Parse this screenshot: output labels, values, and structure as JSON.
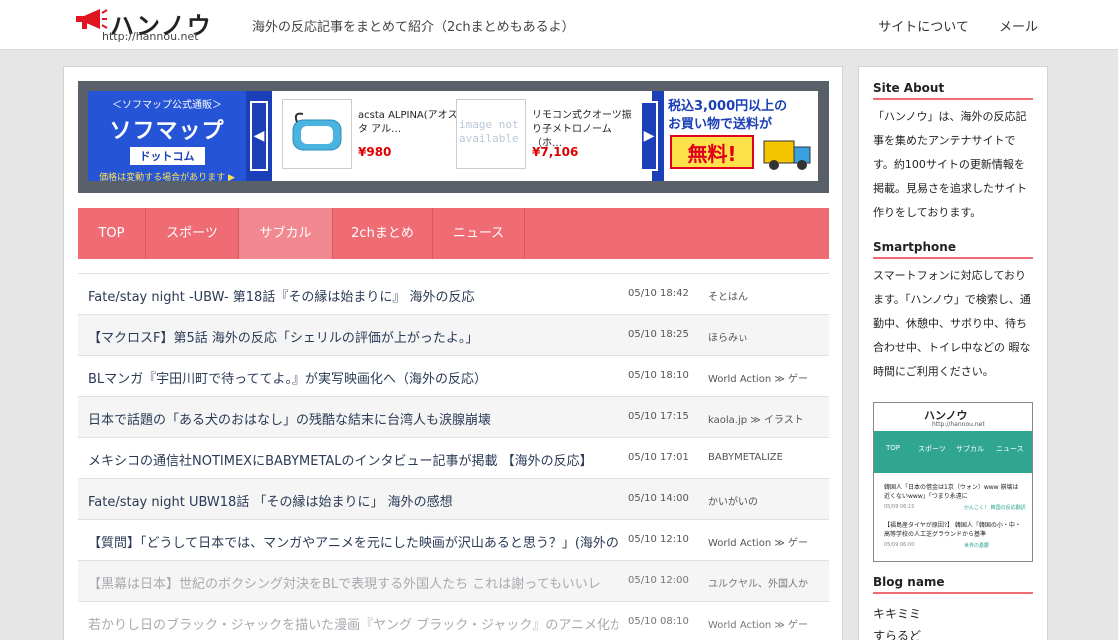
{
  "header": {
    "logo_text": "ハンノウ",
    "logo_url": "http://hannou.net",
    "tagline": "海外の反応記事をまとめて紹介（2chまとめもあるよ）",
    "nav": [
      "サイトについて",
      "メール"
    ]
  },
  "ad": {
    "brand_top": "＜ソフマップ公式通販＞",
    "brand_main": "ソフマップ",
    "brand_sub": "ドットコム",
    "brand_note": "価格は変動する場合があります ▶",
    "products": [
      {
        "name": "acsta ALPINA(アオスタ アル…",
        "price": "¥980"
      },
      {
        "name": "リモコン式クオーツ振り子メトロノーム（ホ…",
        "price": "¥7,106"
      }
    ],
    "no_image": "image not available",
    "promo_1": "税込3,000円以上の",
    "promo_2": "お買い物で送料が",
    "promo_3": "無料!"
  },
  "nav": {
    "items": [
      "TOP",
      "スポーツ",
      "サブカル",
      "2chまとめ",
      "ニュース"
    ],
    "active": "サブカル"
  },
  "articles": [
    {
      "title": "Fate/stay night -UBW- 第18話『その縁は始まりに』 海外の反応",
      "date": "05/10 18:42",
      "source": "そとはん"
    },
    {
      "title": "【マクロスF】第5話 海外の反応「シェリルの評価が上がったよ。」",
      "date": "05/10 18:25",
      "source": "ほらみぃ"
    },
    {
      "title": "BLマンガ『宇田川町で待っててよ。』が実写映画化へ（海外の反応）",
      "date": "05/10 18:10",
      "source": "World Action ≫ ゲー"
    },
    {
      "title": "日本で話題の「ある犬のおはなし」の残酷な結末に台湾人も涙腺崩壊",
      "date": "05/10 17:15",
      "source": "kaola.jp ≫ イラスト"
    },
    {
      "title": "メキシコの通信社NOTIMEXにBABYMETALのインタビュー記事が掲載 【海外の反応】",
      "date": "05/10 17:01",
      "source": "BABYMETALIZE"
    },
    {
      "title": "Fate/stay night UBW18話 「その縁は始まりに」 海外の感想",
      "date": "05/10 14:00",
      "source": "かいがいの"
    },
    {
      "title": "【質問】「どうして日本では、マンガやアニメを元にした映画が沢山あると思う？」(海外の",
      "date": "05/10 12:10",
      "source": "World Action ≫ ゲー"
    },
    {
      "title": "【黒幕は日本】世紀のボクシング対決をBLで表現する外国人たち これは謝ってもいいレ",
      "date": "05/10 12:00",
      "source": "ユルクヤル、外国人か"
    },
    {
      "title": "若かりし日のブラック・ジャックを描いた漫画『ヤング ブラック・ジャック』のアニメ化が決",
      "date": "05/10 08:10",
      "source": "World Action ≫ ゲー"
    }
  ],
  "sidebar": {
    "about_title": "Site About",
    "about_text": "「ハンノウ」は、海外の反応記事を集めたアンテナサイトです。約100サイトの更新情報を掲載。見易さを追求したサイト作りをしております。",
    "smart_title": "Smartphone",
    "smart_text": "スマートフォンに対応しております。「ハンノウ」で検索し、通勤中、休憩中、サボり中、待ち合わせ中、トイレ中などの 暇な時間にご利用ください。",
    "blog_title": "Blog name",
    "blogs": [
      "キキミミ",
      "すらるど"
    ],
    "phone": {
      "logo": "ハンノウ",
      "url": "http://hannou.net",
      "nav": [
        "TOP",
        "スポーツ",
        "サブカル",
        "ニュース"
      ],
      "rows": [
        {
          "title": "韓国人「日本の借金は1京（ウォン）www 崩壊は近くないwww」「つまり永遠に",
          "date": "05/09 06:15",
          "source": "かんこく！ 韓国の反応翻訳"
        },
        {
          "title": "【福島産タイヤが原因?】 韓国人「韓国の小・中・高等学校の人工芝グラウンドから基準",
          "date": "05/09 06:00",
          "source": "世界の憂鬱"
        }
      ]
    }
  }
}
